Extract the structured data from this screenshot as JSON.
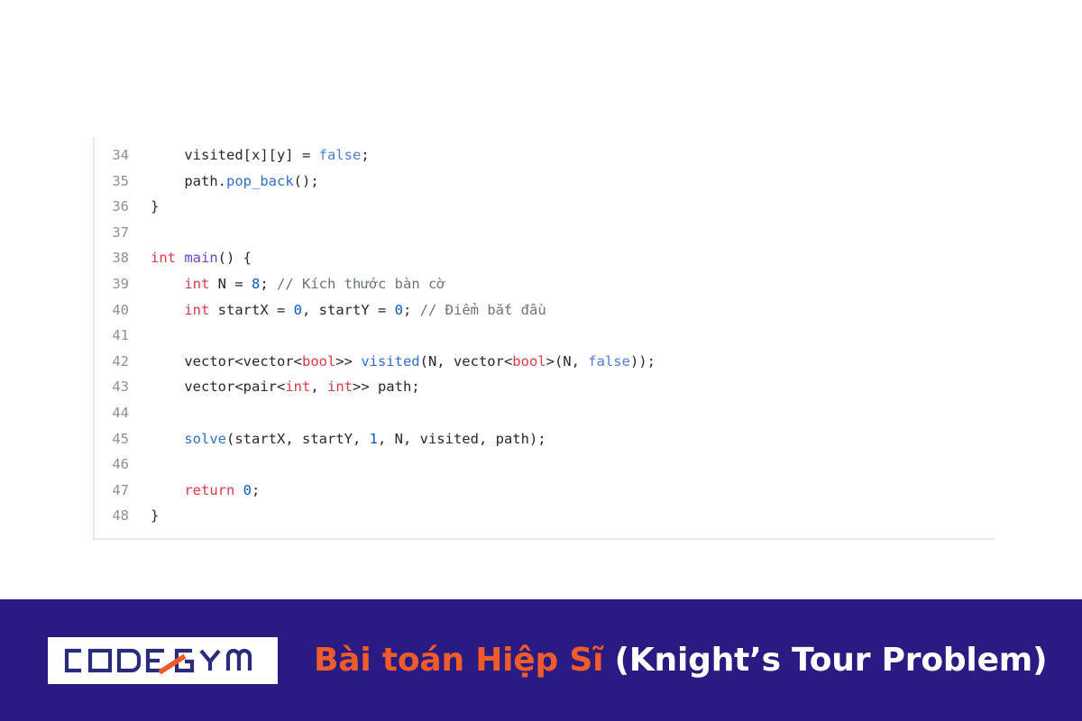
{
  "document": {
    "background_color": "#ffffff"
  },
  "code_block": {
    "language": "cpp",
    "gutter_color": "#8a9099",
    "text_color": "#24292e",
    "colors": {
      "keyword": "#d73a49",
      "function_def": "#6f42c1",
      "function_call": "#2f6fd0",
      "number": "#0a59c2",
      "literal": "#4a7fd4",
      "comment": "#6a737d",
      "border": "#e6e8ea"
    },
    "lines": [
      {
        "number": "34",
        "tokens": [
          {
            "t": "    visited[x][y] = ",
            "c": "plain"
          },
          {
            "t": "false",
            "c": "lit"
          },
          {
            "t": ";",
            "c": "plain"
          }
        ]
      },
      {
        "number": "35",
        "tokens": [
          {
            "t": "    path.",
            "c": "plain"
          },
          {
            "t": "pop_back",
            "c": "call"
          },
          {
            "t": "();",
            "c": "plain"
          }
        ]
      },
      {
        "number": "36",
        "tokens": [
          {
            "t": "}",
            "c": "plain"
          }
        ]
      },
      {
        "number": "37",
        "tokens": []
      },
      {
        "number": "38",
        "tokens": [
          {
            "t": "int",
            "c": "kw"
          },
          {
            "t": " ",
            "c": "plain"
          },
          {
            "t": "main",
            "c": "fn"
          },
          {
            "t": "() {",
            "c": "plain"
          }
        ]
      },
      {
        "number": "39",
        "tokens": [
          {
            "t": "    ",
            "c": "plain"
          },
          {
            "t": "int",
            "c": "kw"
          },
          {
            "t": " N = ",
            "c": "plain"
          },
          {
            "t": "8",
            "c": "num"
          },
          {
            "t": "; ",
            "c": "plain"
          },
          {
            "t": "// Kích thước bàn cờ",
            "c": "cmt"
          }
        ]
      },
      {
        "number": "40",
        "tokens": [
          {
            "t": "    ",
            "c": "plain"
          },
          {
            "t": "int",
            "c": "kw"
          },
          {
            "t": " startX = ",
            "c": "plain"
          },
          {
            "t": "0",
            "c": "num"
          },
          {
            "t": ", startY = ",
            "c": "plain"
          },
          {
            "t": "0",
            "c": "num"
          },
          {
            "t": "; ",
            "c": "plain"
          },
          {
            "t": "// Điểm bắt đầu",
            "c": "cmt"
          }
        ]
      },
      {
        "number": "41",
        "tokens": []
      },
      {
        "number": "42",
        "tokens": [
          {
            "t": "    vector<vector<",
            "c": "plain"
          },
          {
            "t": "bool",
            "c": "kw"
          },
          {
            "t": ">> ",
            "c": "plain"
          },
          {
            "t": "visited",
            "c": "call"
          },
          {
            "t": "(N, vector<",
            "c": "plain"
          },
          {
            "t": "bool",
            "c": "kw"
          },
          {
            "t": ">(N, ",
            "c": "plain"
          },
          {
            "t": "false",
            "c": "lit"
          },
          {
            "t": "));",
            "c": "plain"
          }
        ]
      },
      {
        "number": "43",
        "tokens": [
          {
            "t": "    vector<pair<",
            "c": "plain"
          },
          {
            "t": "int",
            "c": "kw"
          },
          {
            "t": ", ",
            "c": "plain"
          },
          {
            "t": "int",
            "c": "kw"
          },
          {
            "t": ">> path;",
            "c": "plain"
          }
        ]
      },
      {
        "number": "44",
        "tokens": []
      },
      {
        "number": "45",
        "tokens": [
          {
            "t": "    ",
            "c": "plain"
          },
          {
            "t": "solve",
            "c": "call"
          },
          {
            "t": "(startX, startY, ",
            "c": "plain"
          },
          {
            "t": "1",
            "c": "num"
          },
          {
            "t": ", N, visited, path);",
            "c": "plain"
          }
        ]
      },
      {
        "number": "46",
        "tokens": []
      },
      {
        "number": "47",
        "tokens": [
          {
            "t": "    ",
            "c": "plain"
          },
          {
            "t": "return",
            "c": "kw"
          },
          {
            "t": " ",
            "c": "plain"
          },
          {
            "t": "0",
            "c": "num"
          },
          {
            "t": ";",
            "c": "plain"
          }
        ]
      },
      {
        "number": "48",
        "tokens": [
          {
            "t": "}",
            "c": "plain"
          }
        ]
      }
    ]
  },
  "banner": {
    "background_color": "#2a1b82",
    "logo": {
      "text": "CODEGYM",
      "box_color": "#ffffff",
      "letter_color": "#2a2b7c",
      "accent_color": "#f05a28",
      "accent_shape": "diagonal-slash"
    },
    "title_vietnamese": "Bài toán Hiệp Sĩ",
    "title_english": "(Knight’s Tour Problem)",
    "title_vietnamese_color": "#ef5b2b",
    "title_english_color": "#ffffff"
  }
}
